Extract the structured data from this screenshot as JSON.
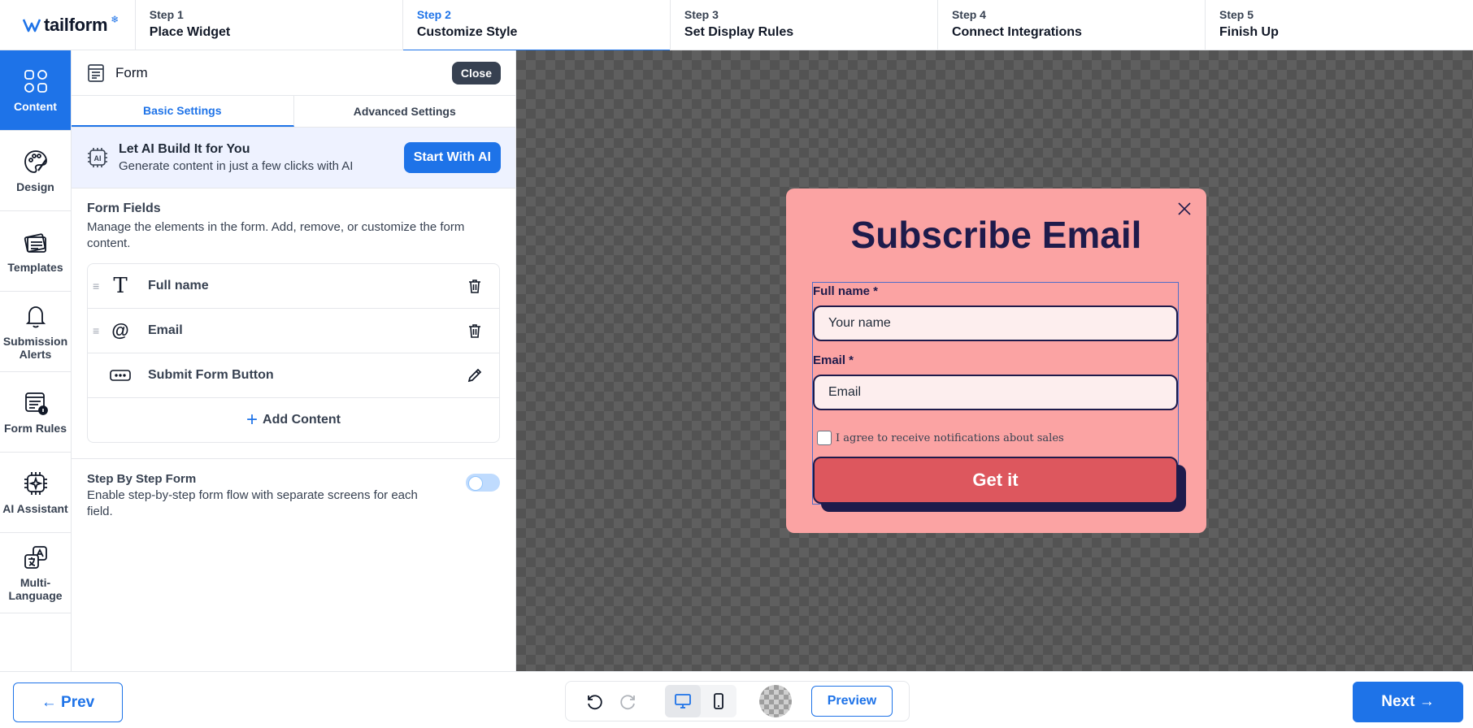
{
  "brand": {
    "name": "tailform",
    "star_icon": "snowflake-icon",
    "accent": "#1e73e8"
  },
  "steps": [
    {
      "num": "Step 1",
      "name": "Place Widget",
      "active": false
    },
    {
      "num": "Step 2",
      "name": "Customize Style",
      "active": true
    },
    {
      "num": "Step 3",
      "name": "Set Display Rules",
      "active": false
    },
    {
      "num": "Step 4",
      "name": "Connect Integrations",
      "active": false
    },
    {
      "num": "Step 5",
      "name": "Finish Up",
      "active": false
    }
  ],
  "rail": [
    {
      "label": "Content",
      "icon": "content-grid-icon",
      "active": true
    },
    {
      "label": "Design",
      "icon": "palette-icon",
      "active": false
    },
    {
      "label": "Templates",
      "icon": "templates-icon",
      "active": false
    },
    {
      "label": "Submission Alerts",
      "icon": "bell-icon",
      "active": false
    },
    {
      "label": "Form Rules",
      "icon": "form-rules-icon",
      "active": false
    },
    {
      "label": "AI Assistant",
      "icon": "ai-chip-icon",
      "active": false
    },
    {
      "label": "Multi-Language",
      "icon": "translate-icon",
      "active": false
    }
  ],
  "panel": {
    "title": "Form",
    "close_label": "Close",
    "tabs": [
      "Basic Settings",
      "Advanced Settings"
    ],
    "ai": {
      "title": "Let AI Build It for You",
      "subtitle": "Generate content in just a few clicks with AI",
      "button": "Start With AI"
    },
    "form_fields": {
      "title": "Form Fields",
      "description": "Manage the elements in the form. Add, remove, or customize the form content.",
      "items": [
        {
          "label": "Full name",
          "icon": "text-type-icon",
          "action": "trash-icon"
        },
        {
          "label": "Email",
          "icon": "at-sign-icon",
          "action": "trash-icon"
        },
        {
          "label": "Submit Form Button",
          "icon": "button-icon",
          "action": "pencil-icon"
        }
      ],
      "add_label": "Add Content"
    },
    "step_by_step": {
      "title": "Step By Step Form",
      "description": "Enable step-by-step form flow with separate screens for each field.",
      "enabled": false
    }
  },
  "popup": {
    "title": "Subscribe Email",
    "bg": "#fba3a3",
    "fields": [
      {
        "label": "Full name *",
        "placeholder": "Your name"
      },
      {
        "label": "Email *",
        "placeholder": "Email"
      }
    ],
    "consent": "I agree to receive notifications about sales",
    "submit": "Get it"
  },
  "bottom": {
    "prev": "← Prev",
    "next": "Next →",
    "preview": "Preview",
    "device": "desktop"
  }
}
